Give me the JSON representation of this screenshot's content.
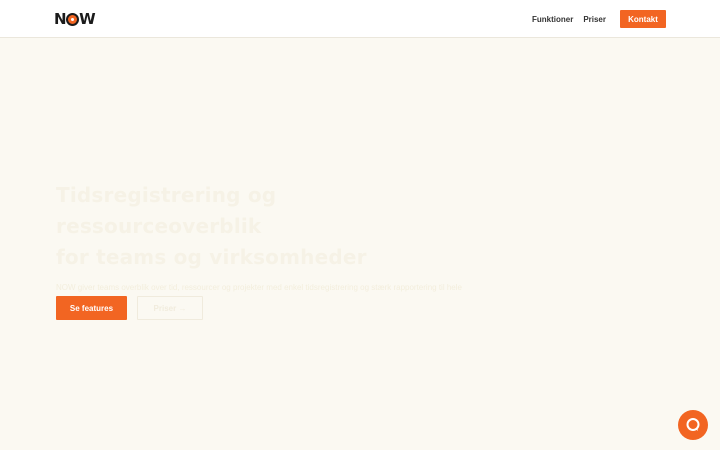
{
  "header": {
    "logo_text_left": "N",
    "logo_text_right": "W",
    "nav": [
      {
        "label": "Funktioner"
      },
      {
        "label": "Priser"
      }
    ],
    "contact_label": "Kontakt"
  },
  "hero": {
    "title_line1": "Tidsregistrering og ressourceoverblik",
    "title_line2": "for teams og virksomheder",
    "subtitle": "NOW giver teams overblik over tid, ressourcer og projekter med enkel tidsregistrering og stærk rapportering til hele virksomheden.",
    "primary_cta": "Se features",
    "secondary_cta": "Priser →"
  },
  "colors": {
    "accent": "#f26522",
    "background": "#fbf9f2",
    "header_bg": "#ffffff"
  },
  "icons": {
    "chat": "chat-bubble-icon"
  }
}
